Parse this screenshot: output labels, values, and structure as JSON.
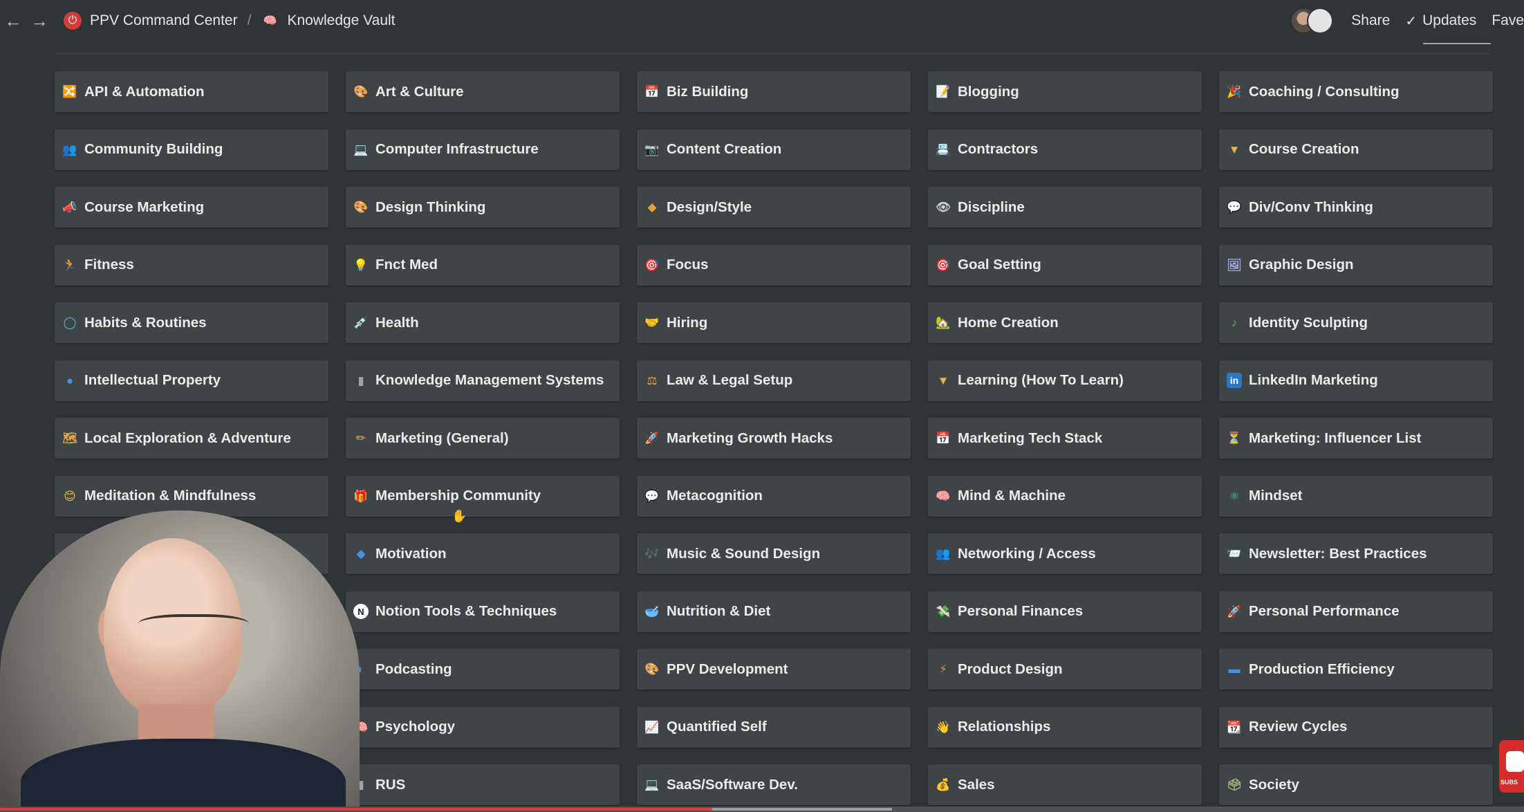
{
  "breadcrumb": {
    "root": "PPV Command Center",
    "separator": "/",
    "current": "Knowledge Vault"
  },
  "topbar": {
    "share_label": "Share",
    "updates_label": "Updates",
    "favorites_label": "Fave"
  },
  "cards": [
    {
      "label": "API & Automation",
      "icon": "🔀",
      "color": "#e0a34a"
    },
    {
      "label": "Art & Culture",
      "icon": "🎨",
      "color": "#d98a5a"
    },
    {
      "label": "Biz Building",
      "icon": "📅",
      "color": "#d94a4a"
    },
    {
      "label": "Blogging",
      "icon": "📝",
      "color": "#d9d4c8"
    },
    {
      "label": "Coaching / Consulting",
      "icon": "🎉",
      "color": "#e0b04a"
    },
    {
      "label": "Community Building",
      "icon": "👥",
      "color": "#e07a3a"
    },
    {
      "label": "Computer Infrastructure",
      "icon": "💻",
      "color": "#8ab4e0"
    },
    {
      "label": "Content Creation",
      "icon": "📷",
      "color": "#8ac4e0"
    },
    {
      "label": "Contractors",
      "icon": "📇",
      "color": "#c8c8c8"
    },
    {
      "label": "Course Creation",
      "icon": "▼",
      "color": "#e0b64a"
    },
    {
      "label": "Course Marketing",
      "icon": "📣",
      "color": "#e0b04a"
    },
    {
      "label": "Design Thinking",
      "icon": "🎨",
      "color": "#d98a5a"
    },
    {
      "label": "Design/Style",
      "icon": "◆",
      "color": "#f0a030"
    },
    {
      "label": "Discipline",
      "icon": "👁",
      "color": "#c8d4e0"
    },
    {
      "label": "Div/Conv Thinking",
      "icon": "💬",
      "color": "#a8c8e8"
    },
    {
      "label": "Fitness",
      "icon": "🏃",
      "color": "#e0a34a"
    },
    {
      "label": "Fnct Med",
      "icon": "💡",
      "color": "#f0c040"
    },
    {
      "label": "Focus",
      "icon": "🎯",
      "color": "#d94a4a"
    },
    {
      "label": "Goal Setting",
      "icon": "🎯",
      "color": "#d9a07a"
    },
    {
      "label": "Graphic Design",
      "icon": "🖼",
      "color": "#a8a8e8"
    },
    {
      "label": "Habits & Routines",
      "icon": "◯",
      "color": "#4ac0d0"
    },
    {
      "label": "Health",
      "icon": "💉",
      "color": "#a0a8b0"
    },
    {
      "label": "Hiring",
      "icon": "🤝",
      "color": "#e0c080"
    },
    {
      "label": "Home Creation",
      "icon": "🏡",
      "color": "#e0c080"
    },
    {
      "label": "Identity Sculpting",
      "icon": "♪",
      "color": "#6ab04a"
    },
    {
      "label": "Intellectual Property",
      "icon": "●",
      "color": "#4a90e0"
    },
    {
      "label": "Knowledge Management Systems",
      "icon": "▮",
      "color": "#a0a0a0"
    },
    {
      "label": "Law & Legal Setup",
      "icon": "⚖",
      "color": "#e0a34a"
    },
    {
      "label": "Learning (How To Learn)",
      "icon": "▼",
      "color": "#e0b64a"
    },
    {
      "label": "LinkedIn Marketing",
      "icon": "in",
      "color": "#3a8ad8"
    },
    {
      "label": "Local Exploration & Adventure",
      "icon": "🗺",
      "color": "#e0a34a"
    },
    {
      "label": "Marketing (General)",
      "icon": "✏",
      "color": "#e0b04a"
    },
    {
      "label": "Marketing Growth Hacks",
      "icon": "🚀",
      "color": "#e07a3a"
    },
    {
      "label": "Marketing Tech Stack",
      "icon": "📅",
      "color": "#d0d0d0"
    },
    {
      "label": "Marketing: Influencer List",
      "icon": "⏳",
      "color": "#e0c080"
    },
    {
      "label": "Meditation & Mindfulness",
      "icon": "😊",
      "color": "#f0c040"
    },
    {
      "label": "Membership Community",
      "icon": "🎁",
      "color": "#d94a4a"
    },
    {
      "label": "Metacognition",
      "icon": "💬",
      "color": "#a8c8e8"
    },
    {
      "label": "Mind & Machine",
      "icon": "🧠",
      "color": "#d05a7a"
    },
    {
      "label": "Mindset",
      "icon": "⚛",
      "color": "#4ac0d0"
    },
    {
      "label": "",
      "icon": "",
      "color": "#3f4447"
    },
    {
      "label": "Motivation",
      "icon": "◆",
      "color": "#4a90e0"
    },
    {
      "label": "Music & Sound Design",
      "icon": "🎶",
      "color": "#8ab4e0"
    },
    {
      "label": "Networking / Access",
      "icon": "👥",
      "color": "#e07a3a"
    },
    {
      "label": "Newsletter: Best Practices",
      "icon": "📨",
      "color": "#e0c080"
    },
    {
      "label": "",
      "icon": "",
      "color": "#3f4447"
    },
    {
      "label": "Notion Tools & Techniques",
      "icon": "N",
      "color": "#e8e8e8"
    },
    {
      "label": "Nutrition & Diet",
      "icon": "🥣",
      "color": "#d94a4a"
    },
    {
      "label": "Personal Finances",
      "icon": "💸",
      "color": "#a0d0a0"
    },
    {
      "label": "Personal Performance",
      "icon": "🚀",
      "color": "#e07a3a"
    },
    {
      "label": "",
      "icon": "",
      "color": "#3f4447"
    },
    {
      "label": "Podcasting",
      "icon": "◐",
      "color": "#4a90e0"
    },
    {
      "label": "PPV Development",
      "icon": "🎨",
      "color": "#d94a4a"
    },
    {
      "label": "Product Design",
      "icon": "⚡",
      "color": "#d98a5a"
    },
    {
      "label": "Production Efficiency",
      "icon": "▬",
      "color": "#4a90e0"
    },
    {
      "label": "",
      "icon": "",
      "color": "#3f4447"
    },
    {
      "label": "Psychology",
      "icon": "🧠",
      "color": "#d05a7a"
    },
    {
      "label": "Quantified Self",
      "icon": "📈",
      "color": "#d94a4a"
    },
    {
      "label": "Relationships",
      "icon": "👋",
      "color": "#f0c040"
    },
    {
      "label": "Review Cycles",
      "icon": "📆",
      "color": "#d94a4a"
    },
    {
      "label": "",
      "icon": "",
      "color": "#3f4447"
    },
    {
      "label": "RUS",
      "icon": "▮",
      "color": "#a0a0a0"
    },
    {
      "label": "SaaS/Software Dev.",
      "icon": "💻",
      "color": "#8ab4e0"
    },
    {
      "label": "Sales",
      "icon": "💰",
      "color": "#e0c080"
    },
    {
      "label": "Society",
      "icon": "🗳",
      "color": "#a0c080"
    }
  ],
  "youtube": {
    "subscribe_label": "SUBS"
  }
}
